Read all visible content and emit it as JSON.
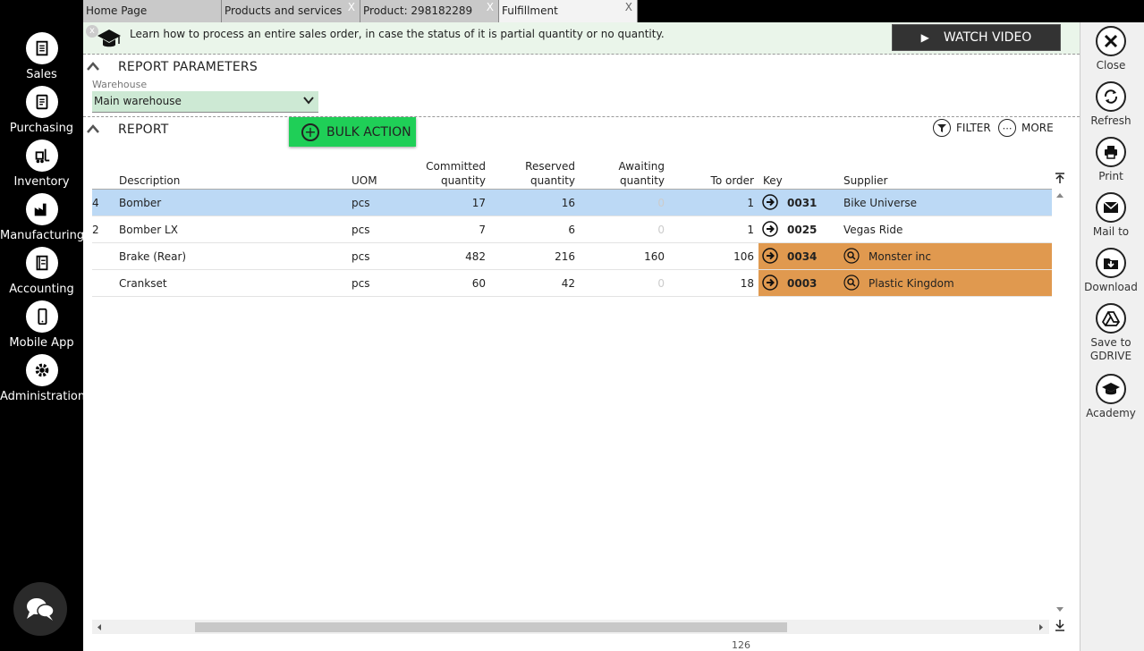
{
  "sidebar": {
    "items": [
      {
        "label": "Sales",
        "icon": "sales-doc-icon"
      },
      {
        "label": "Purchasing",
        "icon": "purchasing-doc-icon"
      },
      {
        "label": "Inventory",
        "icon": "forklift-icon"
      },
      {
        "label": "Manufacturing",
        "icon": "factory-icon"
      },
      {
        "label": "Accounting",
        "icon": "ledger-icon"
      },
      {
        "label": "Mobile App",
        "icon": "phone-icon"
      },
      {
        "label": "Administration",
        "icon": "gear-icon"
      }
    ]
  },
  "tabs": [
    {
      "label": "Home Page",
      "closable": false
    },
    {
      "label": "Products and services",
      "closable": true
    },
    {
      "label": "Product: 298182289",
      "closable": true
    },
    {
      "label": "Fulfillment",
      "closable": true,
      "active": true
    }
  ],
  "banner": {
    "text": "Learn how to process an entire sales order, in case the status of it is partial quantity or no quantity.",
    "close": "x",
    "watch_video": "WATCH VIDEO"
  },
  "report_parameters": {
    "title": "REPORT PARAMETERS",
    "warehouse_label": "Warehouse",
    "warehouse_value": "Main warehouse"
  },
  "report": {
    "title": "REPORT",
    "bulk_action": "BULK ACTION",
    "filter": "FILTER",
    "more": "MORE"
  },
  "table": {
    "headers": {
      "description": "Description",
      "uom": "UOM",
      "committed_1": "Committed",
      "committed_2": "quantity",
      "reserved_1": "Reserved",
      "reserved_2": "quantity",
      "awaiting_1": "Awaiting",
      "awaiting_2": "quantity",
      "to_order": "To order",
      "key": "Key",
      "supplier": "Supplier"
    },
    "rows": [
      {
        "idx": "4",
        "description": "Bomber",
        "uom": "pcs",
        "committed": "17",
        "reserved": "16",
        "awaiting": "0",
        "to_order": "1",
        "key": "0031",
        "supplier": "Bike Universe"
      },
      {
        "idx": "2",
        "description": "Bomber LX",
        "uom": "pcs",
        "committed": "7",
        "reserved": "6",
        "awaiting": "0",
        "to_order": "1",
        "key": "0025",
        "supplier": "Vegas Ride"
      },
      {
        "idx": "",
        "description": "Brake (Rear)",
        "uom": "pcs",
        "committed": "482",
        "reserved": "216",
        "awaiting": "160",
        "to_order": "106",
        "key": "0034",
        "supplier": "Monster inc"
      },
      {
        "idx": "",
        "description": "Crankset",
        "uom": "pcs",
        "committed": "60",
        "reserved": "42",
        "awaiting": "0",
        "to_order": "18",
        "key": "0003",
        "supplier": "Plastic Kingdom"
      }
    ]
  },
  "footer_number": "126",
  "rightbar": {
    "items": [
      {
        "label": "Close",
        "icon": "close-icon"
      },
      {
        "label": "Refresh",
        "icon": "refresh-icon"
      },
      {
        "label": "Print",
        "icon": "print-icon"
      },
      {
        "label": "Mail to",
        "icon": "mail-icon"
      },
      {
        "label": "Download",
        "icon": "download-icon"
      },
      {
        "label": "Save to",
        "label2": "GDRIVE",
        "icon": "gdrive-icon"
      },
      {
        "label": "Academy",
        "icon": "academy-icon"
      }
    ]
  },
  "colors": {
    "selected_row": "#bcd9f5",
    "highlight_supplier": "#e0994f",
    "bulk_action": "#1fcf57",
    "banner_bg": "#eaf5ea"
  }
}
